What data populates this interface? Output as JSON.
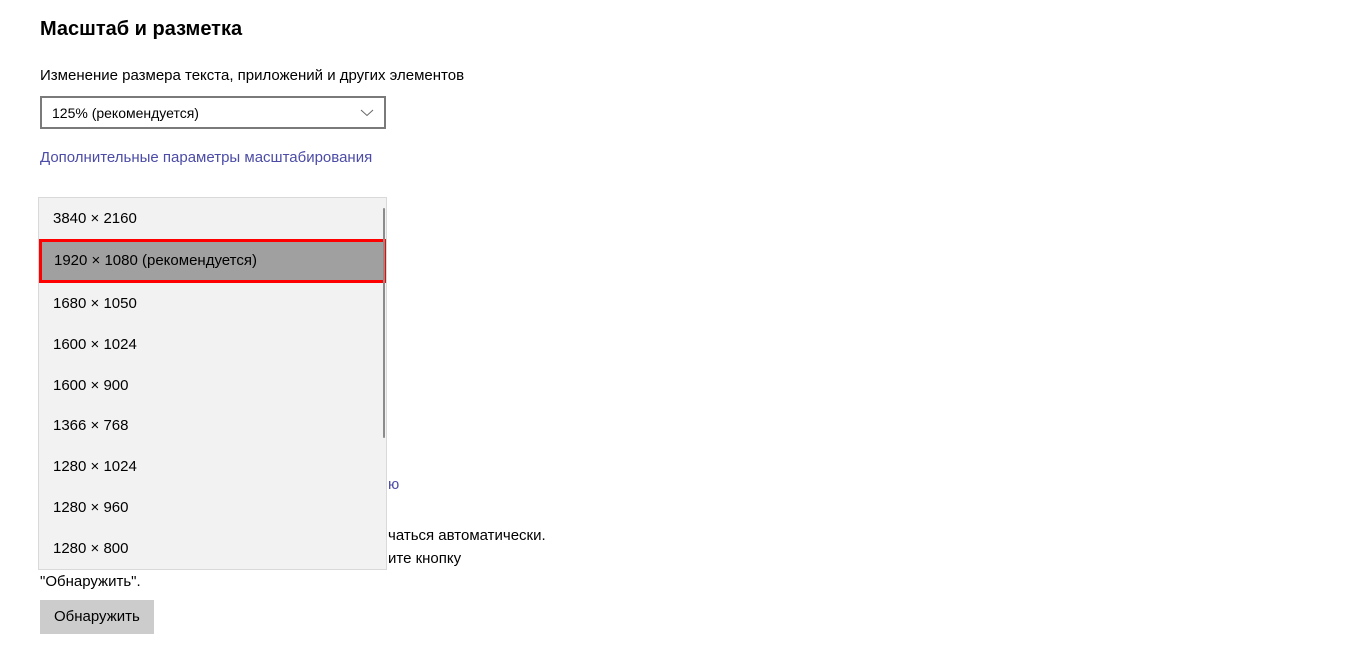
{
  "heading": "Масштаб и разметка",
  "scale": {
    "label": "Изменение размера текста, приложений и других элементов",
    "selected": "125% (рекомендуется)"
  },
  "advancedScaleLink": "Дополнительные параметры масштабирования",
  "resolutionOptions": [
    {
      "label": "3840 × 2160",
      "highlighted": false
    },
    {
      "label": "1920 × 1080 (рекомендуется)",
      "highlighted": true
    },
    {
      "label": "1680 × 1050",
      "highlighted": false
    },
    {
      "label": "1600 × 1024",
      "highlighted": false
    },
    {
      "label": "1600 × 900",
      "highlighted": false
    },
    {
      "label": "1366 × 768",
      "highlighted": false
    },
    {
      "label": "1280 × 1024",
      "highlighted": false
    },
    {
      "label": "1280 × 960",
      "highlighted": false
    },
    {
      "label": "1280 × 800",
      "highlighted": false
    }
  ],
  "behindLinkFragment": "ю",
  "description": {
    "part1": "чаться автоматически.",
    "part2": "ите кнопку",
    "part3": "\"Обнаружить\"."
  },
  "detectButton": "Обнаружить"
}
